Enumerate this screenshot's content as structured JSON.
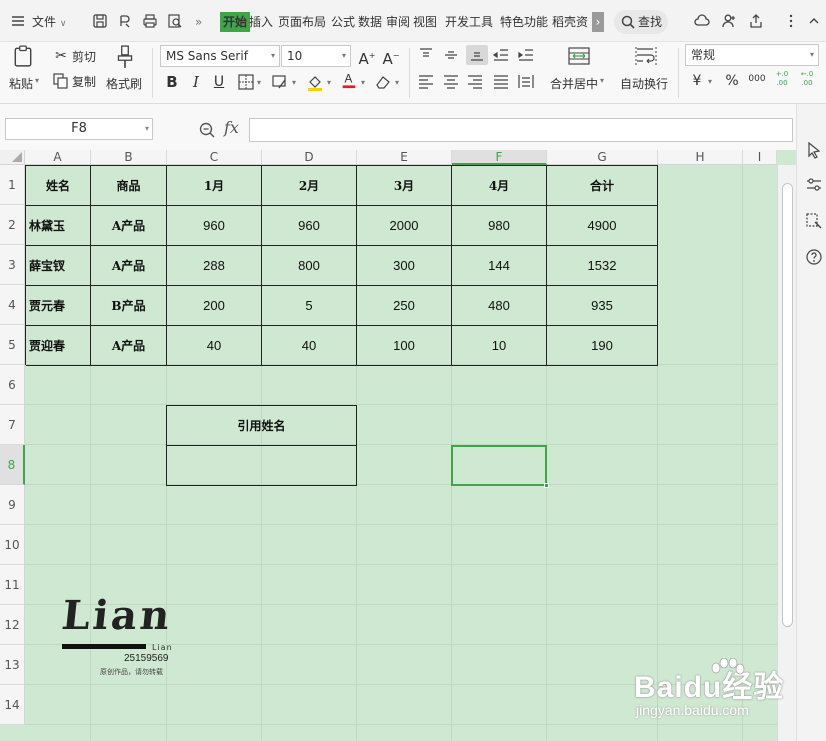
{
  "menubar": {
    "file_label": "文件",
    "tabs": [
      {
        "label": "开始",
        "active": true
      },
      {
        "label": "插入"
      },
      {
        "label": "页面布局"
      },
      {
        "label": "公式"
      },
      {
        "label": "数据"
      },
      {
        "label": "审阅"
      },
      {
        "label": "视图"
      },
      {
        "label": "开发工具"
      },
      {
        "label": "特色功能"
      },
      {
        "label": "稻壳资"
      }
    ],
    "more_label": "›",
    "overflow_label": "»",
    "search_label": "查找",
    "accent_color": "#3fa548"
  },
  "ribbon": {
    "paste_label": "粘贴",
    "cut_label": "剪切",
    "copy_label": "复制",
    "format_painter_label": "格式刷",
    "font_name": "MS Sans Serif",
    "font_size": "10",
    "bold": "B",
    "italic": "I",
    "underline": "U",
    "merge_label": "合并居中",
    "wrap_label": "自动换行",
    "number_format": "常规",
    "currency_symbol": "¥",
    "percent_symbol": "%",
    "thousands_symbol": "000",
    "inc_decimal": "+.0 .00",
    "dec_decimal": "←.0 .00"
  },
  "formula": {
    "name_box": "F8",
    "fx_label": "fx",
    "value": ""
  },
  "grid": {
    "columns": [
      "A",
      "B",
      "C",
      "D",
      "E",
      "F",
      "G",
      "H",
      "I"
    ],
    "selected_column": "F",
    "rows": [
      "1",
      "2",
      "3",
      "4",
      "5",
      "6",
      "7",
      "8",
      "9",
      "10",
      "11",
      "12",
      "13",
      "14"
    ],
    "selected_row": "8",
    "header": [
      "姓名",
      "商品",
      "1月",
      "2月",
      "3月",
      "4月",
      "合计"
    ],
    "data": [
      [
        "林黛玉",
        "A产品",
        "960",
        "960",
        "2000",
        "980",
        "4900"
      ],
      [
        "薛宝钗",
        "A产品",
        "288",
        "800",
        "300",
        "144",
        "1532"
      ],
      [
        "贾元春",
        "B产品",
        "200",
        "5",
        "250",
        "480",
        "935"
      ],
      [
        "贾迎春",
        "A产品",
        "40",
        "40",
        "100",
        "10",
        "190"
      ]
    ],
    "lookup_title": "引用姓名",
    "lookup_value": ""
  },
  "logo": {
    "word": "Lian",
    "small": "Lian",
    "number": "25159569",
    "note": "原创作品，请勿转载"
  },
  "watermark": {
    "text": "Baidu经验",
    "url": "jingyan.baidu.com"
  }
}
